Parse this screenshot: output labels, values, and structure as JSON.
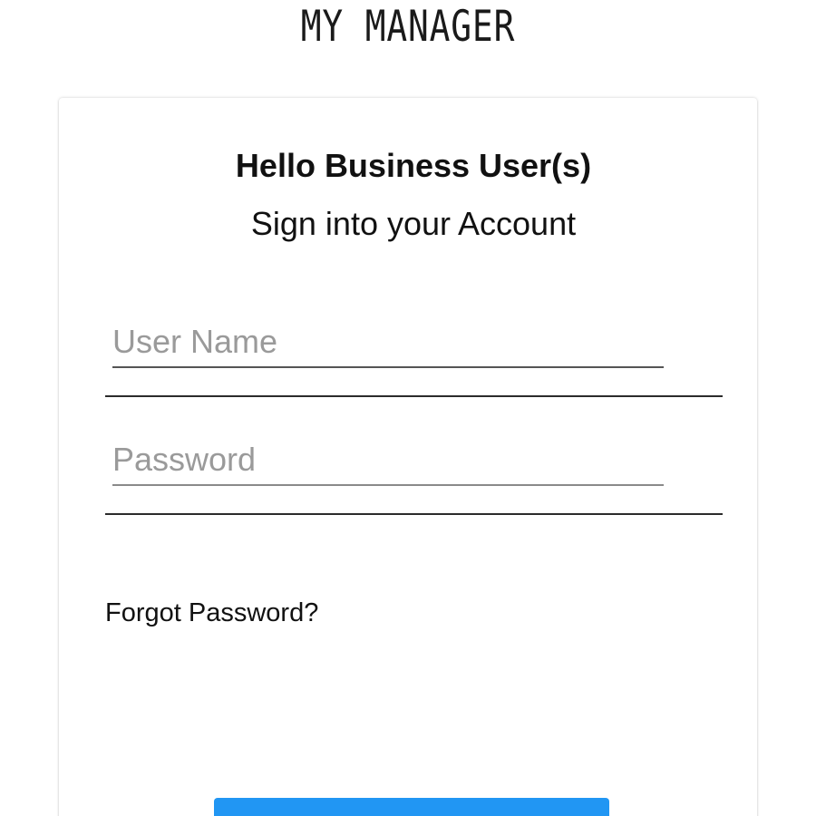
{
  "header": {
    "logo_text": "MY MANAGER"
  },
  "login_card": {
    "greeting": "Hello Business User(s)",
    "subtitle": "Sign into your Account",
    "username_field": {
      "placeholder": "User Name",
      "value": ""
    },
    "password_field": {
      "placeholder": "Password",
      "value": ""
    },
    "forgot_password_label": "Forgot Password?",
    "submit_label": ""
  },
  "colors": {
    "accent": "#2196f3",
    "text": "#111111",
    "placeholder": "#9a9a9a",
    "background": "#ffffff"
  }
}
